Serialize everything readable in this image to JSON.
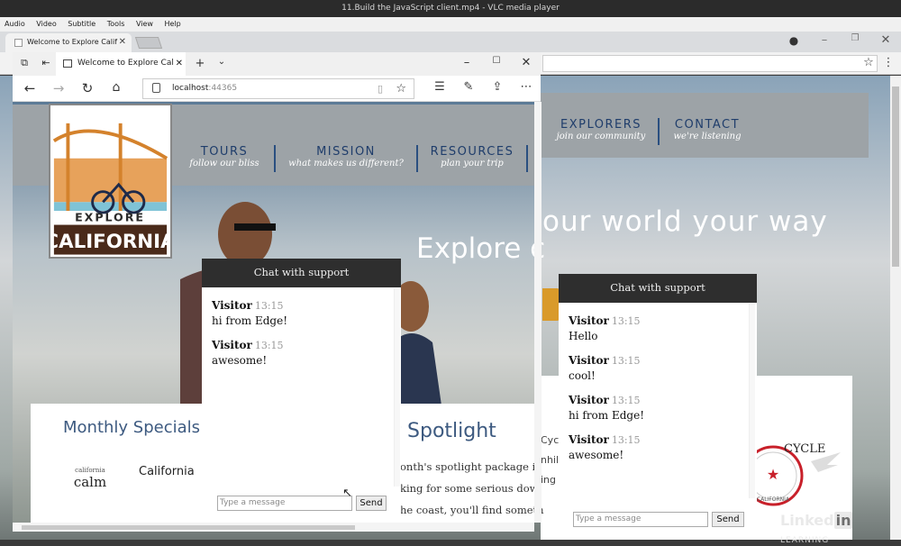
{
  "vlc": {
    "title": "11.Build the JavaScript client.mp4 - VLC media player",
    "menu": [
      "Audio",
      "Video",
      "Subtitle",
      "Tools",
      "View",
      "Help"
    ]
  },
  "chrome": {
    "tab_title": "Welcome to Explore Calif",
    "controls": [
      "account-icon",
      "minimize-icon",
      "restore-icon",
      "close-icon"
    ]
  },
  "edge": {
    "tab_title": "Welcome to Explore Cal",
    "url_host": "localhost",
    "url_port": ":44365"
  },
  "site": {
    "nav": [
      {
        "title": "TOURS",
        "sub": "follow our bliss"
      },
      {
        "title": "MISSION",
        "sub": "what makes us different?"
      },
      {
        "title": "RESOURCES",
        "sub": "plan your trip"
      },
      {
        "title": "EXPLORERS",
        "sub": "join our community"
      },
      {
        "title": "CONTACT",
        "sub": "we're listening"
      }
    ],
    "logo_top": "EXPLORE",
    "logo_bottom": "CALIFORNIA",
    "hero_left": "Explore c",
    "hero_right": "our world your way",
    "monthly_specials": "Monthly Specials",
    "calm_small": "california",
    "calm": "calm",
    "california_label": "California",
    "spotlight": "r Spotlight",
    "spot_lines": [
      "onth's spotlight package is",
      "king for some serious dow",
      "he coast, you'll find someth"
    ],
    "cycle_lines": [
      "Cyc",
      "nhil",
      "ing"
    ],
    "cycle_logo": "CYCLE",
    "cycle_logo_sub": "CALIFORNIA"
  },
  "chat_edge": {
    "header": "Chat with support",
    "messages": [
      {
        "user": "Visitor",
        "time": "13:15",
        "text": "hi from Edge!"
      },
      {
        "user": "Visitor",
        "time": "13:15",
        "text": "awesome!"
      }
    ],
    "placeholder": "Type a message",
    "send": "Send"
  },
  "chat_chrome": {
    "header": "Chat with support",
    "messages": [
      {
        "user": "Visitor",
        "time": "13:15",
        "text": "Hello"
      },
      {
        "user": "Visitor",
        "time": "13:15",
        "text": "cool!"
      },
      {
        "user": "Visitor",
        "time": "13:15",
        "text": "hi from Edge!"
      },
      {
        "user": "Visitor",
        "time": "13:15",
        "text": "awesome!"
      }
    ],
    "placeholder": "Type a message",
    "send": "Send"
  },
  "watermark": {
    "brand": "Linked",
    "brand_in": "in",
    "suffix": "LEARNING"
  }
}
